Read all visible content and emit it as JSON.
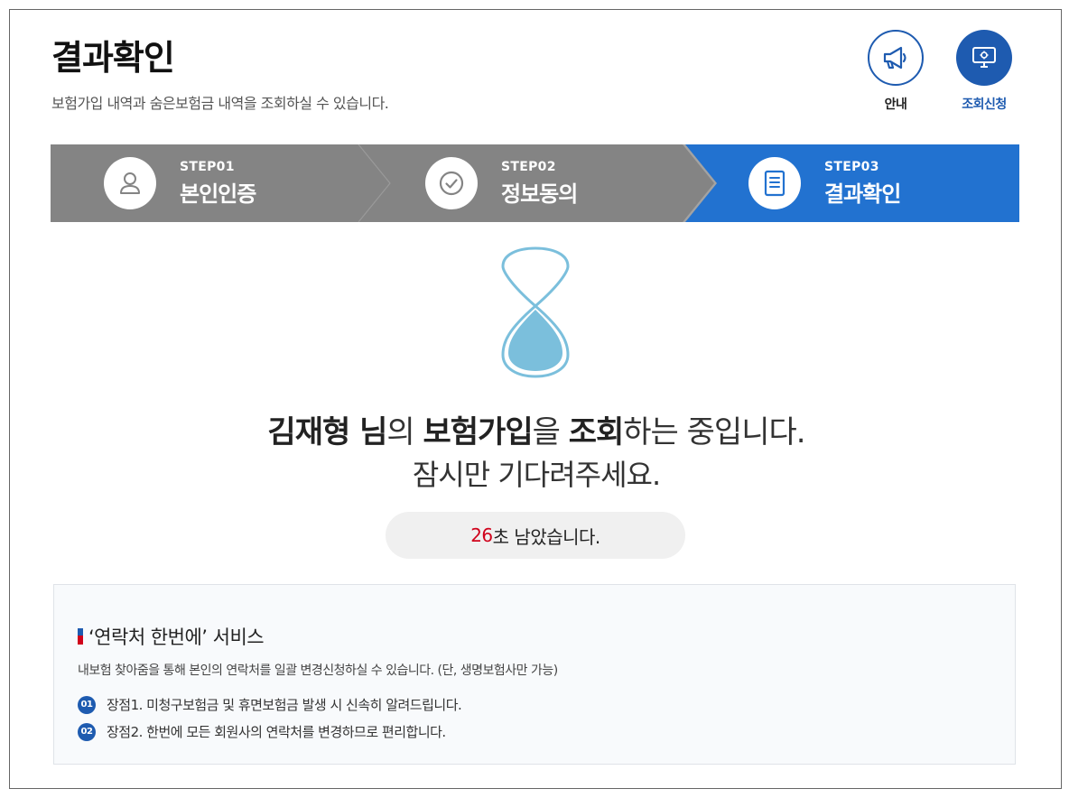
{
  "header": {
    "title": "결과확인",
    "subtitle": "보험가입 내역과 숨은보험금 내역을 조회하실 수 있습니다."
  },
  "top_buttons": {
    "guide_label": "안내",
    "guide_icon": "megaphone-icon",
    "apply_label": "조회신청",
    "apply_icon": "monitor-icon"
  },
  "steps": [
    {
      "num": "STEP01",
      "name": "본인인증",
      "icon": "user-icon",
      "active": false
    },
    {
      "num": "STEP02",
      "name": "정보동의",
      "icon": "check-circle-icon",
      "active": false
    },
    {
      "num": "STEP03",
      "name": "결과확인",
      "icon": "document-icon",
      "active": true
    }
  ],
  "colors": {
    "step_inactive": "#848484",
    "step_active": "#2272d0",
    "accent": "#1e5bb0",
    "countdown": "#d0021b",
    "hourglass": "#7bbfdc"
  },
  "loading": {
    "name": "김재형",
    "name_suffix": " 님",
    "particle1": "의 ",
    "keyword1": "보험가입",
    "particle2": "을 ",
    "keyword2": "조회",
    "rest": "하는 중입니다.",
    "line2": "잠시만 기다려주세요."
  },
  "timer": {
    "seconds": "26",
    "suffix": "초 남았습니다."
  },
  "service": {
    "title": "‘연락처 한번에’ 서비스",
    "description": "내보험 찾아줌을 통해 본인의 연락처를 일괄 변경신청하실 수 있습니다. (단, 생명보험사만 가능)",
    "items": [
      {
        "badge": "01",
        "text": "장점1. 미청구보험금 및 휴면보험금 발생 시 신속히 알려드립니다."
      },
      {
        "badge": "02",
        "text": "장점2. 한번에 모든 회원사의 연락처를 변경하므로 편리합니다."
      }
    ]
  }
}
